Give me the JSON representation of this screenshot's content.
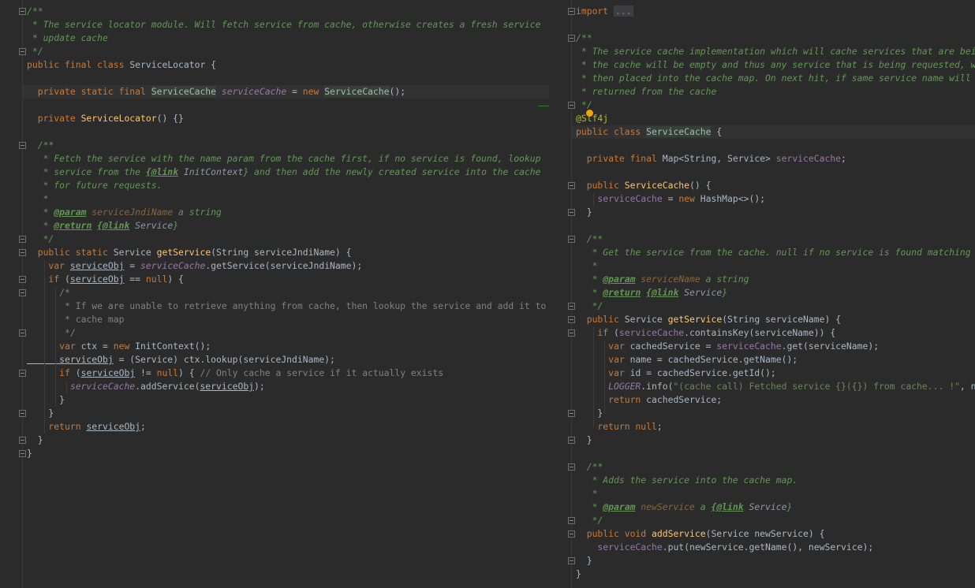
{
  "left": {
    "lines": [
      {
        "parts": [
          [
            "c",
            "/**"
          ]
        ]
      },
      {
        "parts": [
          [
            "c",
            " * The service locator module. Will fetch service from cache, otherwise creates a fresh service"
          ]
        ]
      },
      {
        "parts": [
          [
            "c",
            " * update cache"
          ]
        ]
      },
      {
        "parts": [
          [
            "c",
            " */"
          ]
        ]
      },
      {
        "parts": [
          [
            "k",
            "public final class "
          ],
          [
            "p",
            "ServiceLocator {"
          ]
        ]
      },
      {
        "parts": []
      },
      {
        "parts": [
          [
            "k",
            "  private static final "
          ],
          [
            "hl",
            "ServiceCache"
          ],
          [
            "p",
            " "
          ],
          [
            "f",
            "serviceCache"
          ],
          [
            "p",
            " = "
          ],
          [
            "k",
            "new "
          ],
          [
            "hl",
            "ServiceCache"
          ],
          [
            "p",
            "();"
          ]
        ]
      },
      {
        "parts": []
      },
      {
        "parts": [
          [
            "k",
            "  private "
          ],
          [
            "m",
            "ServiceLocator"
          ],
          [
            "p",
            "() {}"
          ]
        ]
      },
      {
        "parts": []
      },
      {
        "parts": [
          [
            "c",
            "  /**"
          ]
        ]
      },
      {
        "parts": [
          [
            "c",
            "   * Fetch the service with the name param from the cache first, if no service is found, lookup"
          ]
        ]
      },
      {
        "parts": [
          [
            "c",
            "   * service from the "
          ],
          [
            "tag",
            "{@link"
          ],
          [
            "ref",
            " InitContext"
          ],
          [
            "c",
            "} and then add the newly created service into the cache"
          ]
        ]
      },
      {
        "parts": [
          [
            "c",
            "   * for future requests."
          ]
        ]
      },
      {
        "parts": [
          [
            "c",
            "   *"
          ]
        ]
      },
      {
        "parts": [
          [
            "c",
            "   * "
          ],
          [
            "tag",
            "@param"
          ],
          [
            "par",
            " serviceJndiName"
          ],
          [
            "c",
            " a string"
          ]
        ]
      },
      {
        "parts": [
          [
            "c",
            "   * "
          ],
          [
            "tag",
            "@return"
          ],
          [
            "c",
            " "
          ],
          [
            "tag",
            "{@link"
          ],
          [
            "ref",
            " Service"
          ],
          [
            "c",
            "}"
          ]
        ]
      },
      {
        "parts": [
          [
            "c",
            "   */"
          ]
        ]
      },
      {
        "parts": [
          [
            "k",
            "  public static "
          ],
          [
            "p",
            "Service "
          ],
          [
            "m",
            "getService"
          ],
          [
            "p",
            "(String serviceJndiName) {"
          ]
        ]
      },
      {
        "parts": [
          [
            "k",
            "    var "
          ],
          [
            "u",
            "serviceObj"
          ],
          [
            "p",
            " = "
          ],
          [
            "f",
            "serviceCache"
          ],
          [
            "p",
            ".getService(serviceJndiName);"
          ]
        ]
      },
      {
        "parts": [
          [
            "k",
            "    if "
          ],
          [
            "p",
            "("
          ],
          [
            "u",
            "serviceObj"
          ],
          [
            "p",
            " == "
          ],
          [
            "k",
            "null"
          ],
          [
            "p",
            ") {"
          ]
        ]
      },
      {
        "parts": [
          [
            "cm",
            "      /*"
          ]
        ]
      },
      {
        "parts": [
          [
            "cm",
            "       * If we are unable to retrieve anything from cache, then lookup the service and add it to the"
          ]
        ]
      },
      {
        "parts": [
          [
            "cm",
            "       * cache map"
          ]
        ]
      },
      {
        "parts": [
          [
            "cm",
            "       */"
          ]
        ]
      },
      {
        "parts": [
          [
            "k",
            "      var "
          ],
          [
            "p",
            "ctx = "
          ],
          [
            "k",
            "new "
          ],
          [
            "p",
            "InitContext();"
          ]
        ]
      },
      {
        "parts": [
          [
            "u",
            "      serviceObj"
          ],
          [
            "p",
            " = (Service) ctx.lookup(serviceJndiName);"
          ]
        ]
      },
      {
        "parts": [
          [
            "k",
            "      if "
          ],
          [
            "p",
            "("
          ],
          [
            "u",
            "serviceObj"
          ],
          [
            "p",
            " != "
          ],
          [
            "k",
            "null"
          ],
          [
            "p",
            ") { "
          ],
          [
            "lc",
            "// Only cache a service if it actually exists"
          ]
        ]
      },
      {
        "parts": [
          [
            "f",
            "        serviceCache"
          ],
          [
            "p",
            ".addService("
          ],
          [
            "u",
            "serviceObj"
          ],
          [
            "p",
            ");"
          ]
        ]
      },
      {
        "parts": [
          [
            "p",
            "      }"
          ]
        ]
      },
      {
        "parts": [
          [
            "p",
            "    }"
          ]
        ]
      },
      {
        "parts": [
          [
            "k",
            "    return "
          ],
          [
            "u",
            "serviceObj"
          ],
          [
            "p",
            ";"
          ]
        ]
      },
      {
        "parts": [
          [
            "p",
            "  }"
          ]
        ]
      },
      {
        "parts": [
          [
            "p",
            "}"
          ]
        ]
      }
    ]
  },
  "right": {
    "lines": [
      {
        "parts": [
          [
            "k",
            "import "
          ],
          [
            "fold",
            "..."
          ]
        ]
      },
      {
        "parts": []
      },
      {
        "parts": [
          [
            "c",
            "/**"
          ]
        ]
      },
      {
        "parts": [
          [
            "c",
            " * The service cache implementation which will cache services that are being created. On first hit,"
          ]
        ]
      },
      {
        "parts": [
          [
            "c",
            " * the cache will be empty and thus any service that is being requested, will be created fresh and"
          ]
        ]
      },
      {
        "parts": [
          [
            "c",
            " * then placed into the cache map. On next hit, if same service name will be requested, it will be"
          ]
        ]
      },
      {
        "parts": [
          [
            "c",
            " * returned from the cache"
          ]
        ]
      },
      {
        "parts": [
          [
            "c",
            " */"
          ]
        ]
      },
      {
        "parts": [
          [
            "ann",
            "@Slf4j"
          ]
        ]
      },
      {
        "parts": [
          [
            "k",
            "public class "
          ],
          [
            "hl",
            "ServiceCache"
          ],
          [
            "p",
            " {"
          ]
        ]
      },
      {
        "parts": []
      },
      {
        "parts": [
          [
            "k",
            "  private final "
          ],
          [
            "p",
            "Map<String, Service> "
          ],
          [
            "if",
            "serviceCache"
          ],
          [
            "p",
            ";"
          ]
        ]
      },
      {
        "parts": []
      },
      {
        "parts": [
          [
            "k",
            "  public "
          ],
          [
            "m",
            "ServiceCache"
          ],
          [
            "p",
            "() {"
          ]
        ]
      },
      {
        "parts": [
          [
            "if",
            "    serviceCache"
          ],
          [
            "p",
            " = "
          ],
          [
            "k",
            "new "
          ],
          [
            "p",
            "HashMap<>();"
          ]
        ]
      },
      {
        "parts": [
          [
            "p",
            "  }"
          ]
        ]
      },
      {
        "parts": []
      },
      {
        "parts": [
          [
            "c",
            "  /**"
          ]
        ]
      },
      {
        "parts": [
          [
            "c",
            "   * Get the service from the cache. null if no service is found matching the name"
          ]
        ]
      },
      {
        "parts": [
          [
            "c",
            "   *"
          ]
        ]
      },
      {
        "parts": [
          [
            "c",
            "   * "
          ],
          [
            "tag",
            "@param"
          ],
          [
            "par",
            " serviceName"
          ],
          [
            "c",
            " a string"
          ]
        ]
      },
      {
        "parts": [
          [
            "c",
            "   * "
          ],
          [
            "tag",
            "@return"
          ],
          [
            "c",
            " "
          ],
          [
            "tag",
            "{@link"
          ],
          [
            "ref",
            " Service"
          ],
          [
            "c",
            "}"
          ]
        ]
      },
      {
        "parts": [
          [
            "c",
            "   */"
          ]
        ]
      },
      {
        "parts": [
          [
            "k",
            "  public "
          ],
          [
            "p",
            "Service "
          ],
          [
            "m",
            "getService"
          ],
          [
            "p",
            "(String serviceName) {"
          ]
        ]
      },
      {
        "parts": [
          [
            "k",
            "    if "
          ],
          [
            "p",
            "("
          ],
          [
            "if",
            "serviceCache"
          ],
          [
            "p",
            ".containsKey(serviceName)) {"
          ]
        ]
      },
      {
        "parts": [
          [
            "k",
            "      var "
          ],
          [
            "p",
            "cachedService = "
          ],
          [
            "if",
            "serviceCache"
          ],
          [
            "p",
            ".get(serviceName);"
          ]
        ]
      },
      {
        "parts": [
          [
            "k",
            "      var "
          ],
          [
            "p",
            "name = cachedService.getName();"
          ]
        ]
      },
      {
        "parts": [
          [
            "k",
            "      var "
          ],
          [
            "p",
            "id = cachedService.getId();"
          ]
        ]
      },
      {
        "parts": [
          [
            "log",
            "      LOGGER"
          ],
          [
            "p",
            ".info("
          ],
          [
            "s",
            "\"(cache call) Fetched service {}({}) from cache... !\""
          ],
          [
            "p",
            ", name, id);"
          ]
        ]
      },
      {
        "parts": [
          [
            "k",
            "      return "
          ],
          [
            "p",
            "cachedService;"
          ]
        ]
      },
      {
        "parts": [
          [
            "p",
            "    }"
          ]
        ]
      },
      {
        "parts": [
          [
            "k",
            "    return null"
          ],
          [
            "p",
            ";"
          ]
        ]
      },
      {
        "parts": [
          [
            "p",
            "  }"
          ]
        ]
      },
      {
        "parts": []
      },
      {
        "parts": [
          [
            "c",
            "  /**"
          ]
        ]
      },
      {
        "parts": [
          [
            "c",
            "   * Adds the service into the cache map."
          ]
        ]
      },
      {
        "parts": [
          [
            "c",
            "   *"
          ]
        ]
      },
      {
        "parts": [
          [
            "c",
            "   * "
          ],
          [
            "tag",
            "@param"
          ],
          [
            "par",
            " newService"
          ],
          [
            "c",
            " a "
          ],
          [
            "tag",
            "{@link"
          ],
          [
            "ref",
            " Service"
          ],
          [
            "c",
            "}"
          ]
        ]
      },
      {
        "parts": [
          [
            "c",
            "   */"
          ]
        ]
      },
      {
        "parts": [
          [
            "k",
            "  public void "
          ],
          [
            "m",
            "addService"
          ],
          [
            "p",
            "(Service newService) {"
          ]
        ]
      },
      {
        "parts": [
          [
            "if",
            "    serviceCache"
          ],
          [
            "p",
            ".put(newService.getName(), newService);"
          ]
        ]
      },
      {
        "parts": [
          [
            "p",
            "  }"
          ]
        ]
      },
      {
        "parts": [
          [
            "p",
            "}"
          ]
        ]
      }
    ]
  }
}
